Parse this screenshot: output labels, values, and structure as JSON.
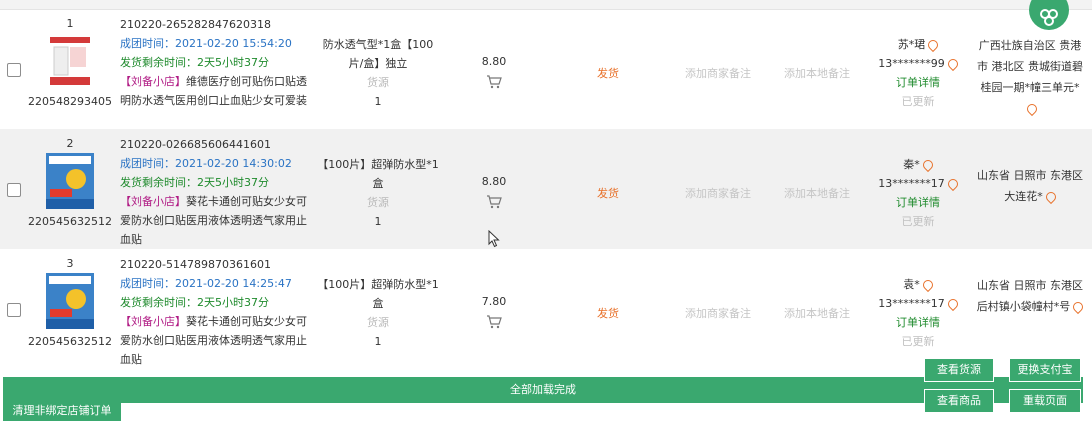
{
  "orders": [
    {
      "index": "1",
      "product_id": "220548293405",
      "order_no": "210220-265282847620318",
      "time": "成团时间：2021-02-20 15:54:20",
      "remain": "发货剩余时间：2天5小时37分",
      "store": "【刘备小店】",
      "title": "维德医疗创可贴伤口贴透明防水透气医用创口止血贴少女可爱装",
      "spec": "防水透气型*1盒【100片/盒】独立",
      "source": "货源",
      "qty": "1",
      "price": "8.80",
      "ship": "发货",
      "merchant_note": "添加商家备注",
      "local_note": "添加本地备注",
      "buyer": "苏*珺",
      "phone": "13*******99",
      "detail": "订单详情",
      "updated": "已更新",
      "address": "广西壮族自治区 贵港市 港北区 贵城街道碧桂园一期*幢三单元*"
    },
    {
      "index": "2",
      "product_id": "220545632512",
      "order_no": "210220-026685606441601",
      "time": "成团时间：2021-02-20 14:30:02",
      "remain": "发货剩余时间：2天5小时37分",
      "store": "【刘备小店】",
      "title": "葵花卡通创可贴女少女可爱防水创口贴医用液体透明透气家用止血贴",
      "spec": "【100片】超弹防水型*1盒",
      "source": "货源",
      "qty": "1",
      "price": "8.80",
      "ship": "发货",
      "merchant_note": "添加商家备注",
      "local_note": "添加本地备注",
      "buyer": "秦*",
      "phone": "13*******17",
      "detail": "订单详情",
      "updated": "已更新",
      "address": "山东省 日照市 东港区 大连花*"
    },
    {
      "index": "3",
      "product_id": "220545632512",
      "order_no": "210220-514789870361601",
      "time": "成团时间：2021-02-20 14:25:47",
      "remain": "发货剩余时间：2天5小时37分",
      "store": "【刘备小店】",
      "title": "葵花卡通创可贴女少女可爱防水创口贴医用液体透明透气家用止血贴",
      "spec": "【100片】超弹防水型*1盒",
      "source": "货源",
      "qty": "1",
      "price": "7.80",
      "ship": "发货",
      "merchant_note": "添加商家备注",
      "local_note": "添加本地备注",
      "buyer": "袁*",
      "phone": "13*******17",
      "detail": "订单详情",
      "updated": "已更新",
      "address": "山东省 日照市 东港区 后村镇小袋幢村*号"
    }
  ],
  "footer": {
    "loaded": "全部加载完成",
    "clear_orders": "清理非绑定店铺订单",
    "view_source": "查看货源",
    "change_alipay": "更换支付宝",
    "view_product": "查看商品",
    "reload": "重载页面"
  },
  "colors": {
    "accent": "#3aa86f",
    "time_blue": "#2a73c4",
    "remain_green": "#1e8a2c",
    "store_magenta": "#b01a84",
    "ship_orange": "#e8712a"
  },
  "icons": [
    "cart-icon",
    "location-pin-icon",
    "mouse-cursor-icon",
    "floating-action-icon"
  ]
}
